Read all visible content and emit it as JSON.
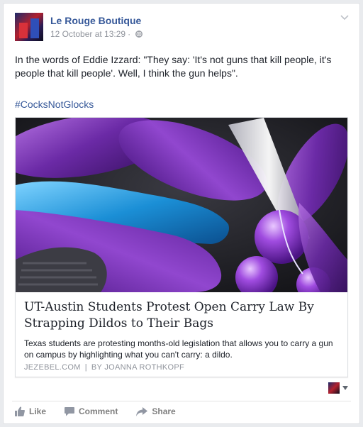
{
  "post": {
    "page_name": "Le Rouge Boutique",
    "timestamp": "12 October at 13:29",
    "separator": "·",
    "text": "In the words of Eddie Izzard: \"They say: 'It's not guns that kill people, it's people that kill people'. Well, I think the gun helps\".",
    "hashtag": "#CocksNotGlocks"
  },
  "link": {
    "title": "UT-Austin Students Protest Open Carry Law By Strapping Dildos to Their Bags",
    "description": "Texas students are protesting months-old legislation that allows you to carry a gun on campus by highlighting what you can't carry: a dildo.",
    "source": "JEZEBEL.COM",
    "separator": "|",
    "byline": "BY JOANNA ROTHKOPF"
  },
  "actions": {
    "like": "Like",
    "comment": "Comment",
    "share": "Share"
  },
  "colors": {
    "link_blue": "#365899",
    "meta_gray": "#90949c",
    "action_gray": "#7f7f7f"
  },
  "icons": [
    "globe-icon",
    "chevron-down-icon",
    "like-icon",
    "comment-icon",
    "share-icon",
    "caret-down-icon"
  ]
}
